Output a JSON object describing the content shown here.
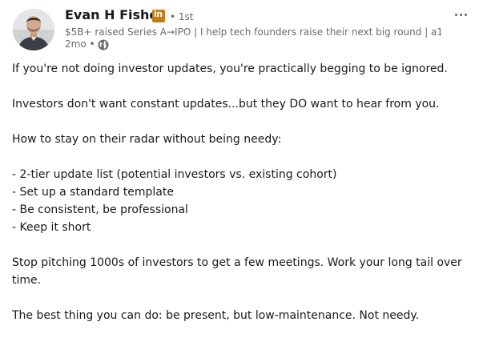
{
  "author": {
    "name": "Evan H Fisher",
    "badge_text": "in",
    "degree": "• 1st",
    "headline": "$5B+ raised Series A→IPO | I help tech founders raise their next big round | a1...",
    "time": "2mo •",
    "visibility_icon": "globe-icon",
    "badge_color": "#c37d16"
  },
  "menu": {
    "icon": "more-horizontal-icon"
  },
  "post": {
    "para1": "If you're not doing investor updates, you're practically begging to be ignored.",
    "para2": "Investors don't want constant updates...but they DO want to hear from you.",
    "para3": "How to stay on their radar without being needy:",
    "list": [
      "- 2-tier update list (potential investors vs. existing cohort)",
      "- Set up a standard template",
      "- Be consistent, be professional",
      "- Keep it short"
    ],
    "para4": "Stop pitching 1000s of investors to get a few meetings. Work your long tail over time.",
    "para5": "The best thing you can do: be present, but low-maintenance. Not needy."
  }
}
